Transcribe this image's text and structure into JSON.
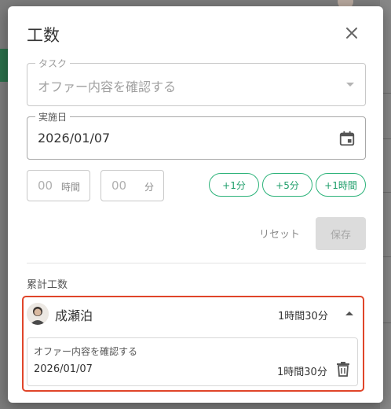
{
  "dialog": {
    "title": "工数",
    "task": {
      "label": "タスク",
      "value": "オファー内容を確認する"
    },
    "date": {
      "label": "実施日",
      "value": "2026/01/07"
    },
    "hours": {
      "value": "00",
      "unit": "時間"
    },
    "minutes": {
      "value": "00",
      "unit": "分"
    },
    "quick_add": [
      "+1分",
      "+5分",
      "+1時間"
    ],
    "reset_label": "リセット",
    "save_label": "保存",
    "accumulated": {
      "title": "累計工数",
      "user": {
        "name": "成瀬泊",
        "total": "1時間30分"
      },
      "entries": [
        {
          "task": "オファー内容を確認する",
          "date": "2026/01/07",
          "time": "1時間30分"
        }
      ]
    }
  },
  "colors": {
    "accent_green": "#1e9e6a",
    "highlight_red": "#e0452a",
    "save_disabled_bg": "#dcdcdc"
  },
  "icons": [
    "close-icon",
    "calendar-icon",
    "chevron-down-icon",
    "chevron-up-icon",
    "trash-icon",
    "avatar"
  ]
}
